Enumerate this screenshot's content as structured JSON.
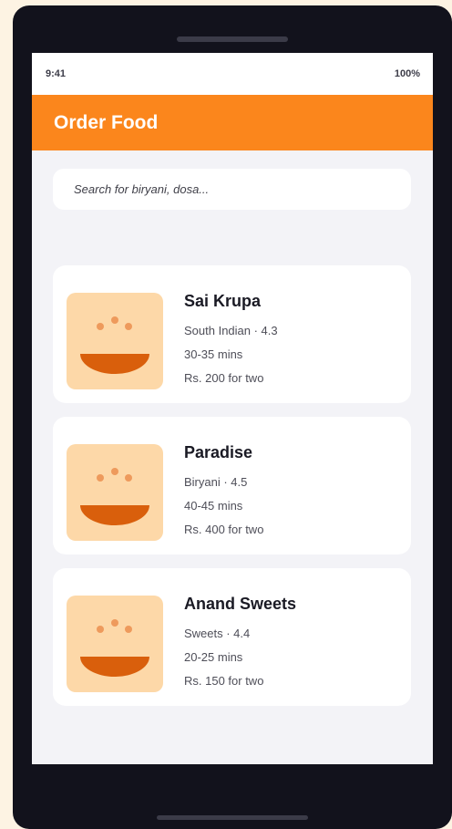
{
  "status_bar": {
    "time": "9:41",
    "battery": "100%"
  },
  "header": {
    "title": "Order Food"
  },
  "search": {
    "placeholder": "Search for biryani, dosa..."
  },
  "restaurants": [
    {
      "name": "Sai Krupa",
      "cuisine_rating": "South Indian · 4.3",
      "delivery_time": "30-35 mins",
      "price": "Rs. 200 for two"
    },
    {
      "name": "Paradise",
      "cuisine_rating": "Biryani · 4.5",
      "delivery_time": "40-45 mins",
      "price": "Rs. 400 for two"
    },
    {
      "name": "Anand Sweets",
      "cuisine_rating": "Sweets · 4.4",
      "delivery_time": "20-25 mins",
      "price": "Rs. 150 for two"
    }
  ],
  "colors": {
    "accent": "#fb861c",
    "thumb_bg": "#fdd8a8",
    "bowl": "#d95f0c"
  },
  "icons": {
    "restaurant_thumbnail": "food-bowl-icon"
  }
}
